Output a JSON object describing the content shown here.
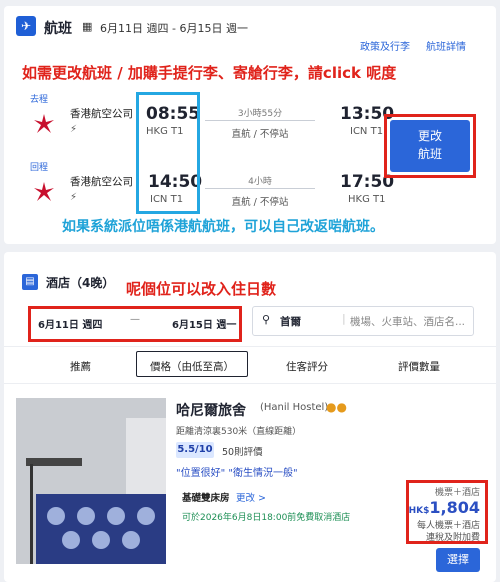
{
  "flight": {
    "title": "航班",
    "date_range": "6月11日 週四 - 6月15日 週一",
    "links": [
      "政策及行李",
      "航班詳情"
    ],
    "annotation_top": "如需更改航班 / 加購手提行李、寄艙行李，請click 呢度",
    "annotation_bottom": "如果系統派位唔係港航航班，可以自己改返啱航班。",
    "outbound": {
      "tag": "去程",
      "airline": "香港航空公司",
      "dep_time": "08:55",
      "dep_airport": "HKG T1",
      "duration": "3小時55分",
      "route_type": "直航 / 不停站",
      "arr_time": "13:50",
      "arr_airport": "ICN T1"
    },
    "inbound": {
      "tag": "回程",
      "airline": "香港航空公司",
      "dep_time": "14:50",
      "dep_airport": "ICN T1",
      "duration": "4小時",
      "route_type": "直航 / 不停站",
      "arr_time": "17:50",
      "arr_airport": "HKG T1"
    },
    "change_button": "更改\n航班"
  },
  "hotel": {
    "title": "酒店（4晚）",
    "annotation": "呢個位可以改入住日數",
    "date_from": "6月11日 週四",
    "date_dash": "—",
    "date_to": "6月15日 週一",
    "city": "首爾",
    "search_placeholder": "機場、火車站、酒店名...",
    "tabs": [
      "推薦",
      "價格（由低至高）",
      "住客評分",
      "評價數量"
    ],
    "name": "哈尼爾旅舍",
    "name_en": "(Hanil Hostel)",
    "distance": "距離清涼裏530米（直線距離）",
    "score": "5.5/10",
    "reviews": "50則評價",
    "quotes": "\"位置很好\"  \"衛生情況一般\"",
    "room_type": "基礎雙床房",
    "room_change": "更改 >",
    "cancel_policy": "可於2026年6月8日18:00前免費取消酒店",
    "price_label": "機票＋酒店",
    "currency": "HK$",
    "price": "1,804",
    "per_person": "每人機票＋酒店",
    "tax": "連稅及附加費",
    "select_button": "選擇"
  },
  "colors": {
    "primary": "#2b66d9",
    "annotation_red": "#e0231b",
    "annotation_cyan": "#1fa3d8"
  }
}
